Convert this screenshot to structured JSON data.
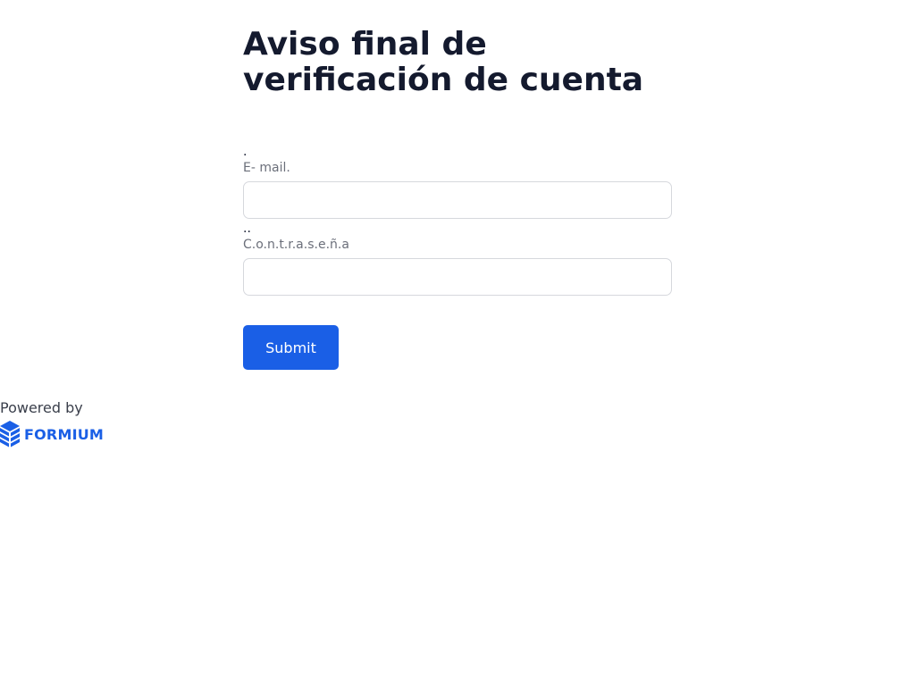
{
  "form": {
    "title": "Aviso final de verificación de cuenta",
    "email": {
      "dot": ".",
      "label": "E- mail.",
      "value": "",
      "placeholder": ""
    },
    "password": {
      "dot": "..",
      "label": "C.o.n.t.r.a.s.e.ñ.a",
      "value": "",
      "placeholder": ""
    },
    "submit_label": "Submit"
  },
  "footer": {
    "powered_by": "Powered by",
    "brand": "FORMIUM",
    "brand_icon": "formium-logo-icon",
    "brand_color": "#1a5fe6"
  },
  "colors": {
    "title": "#141a2e",
    "label": "#6b6f7a",
    "button": "#1a5fe6",
    "input_border": "#d6d8dd"
  }
}
